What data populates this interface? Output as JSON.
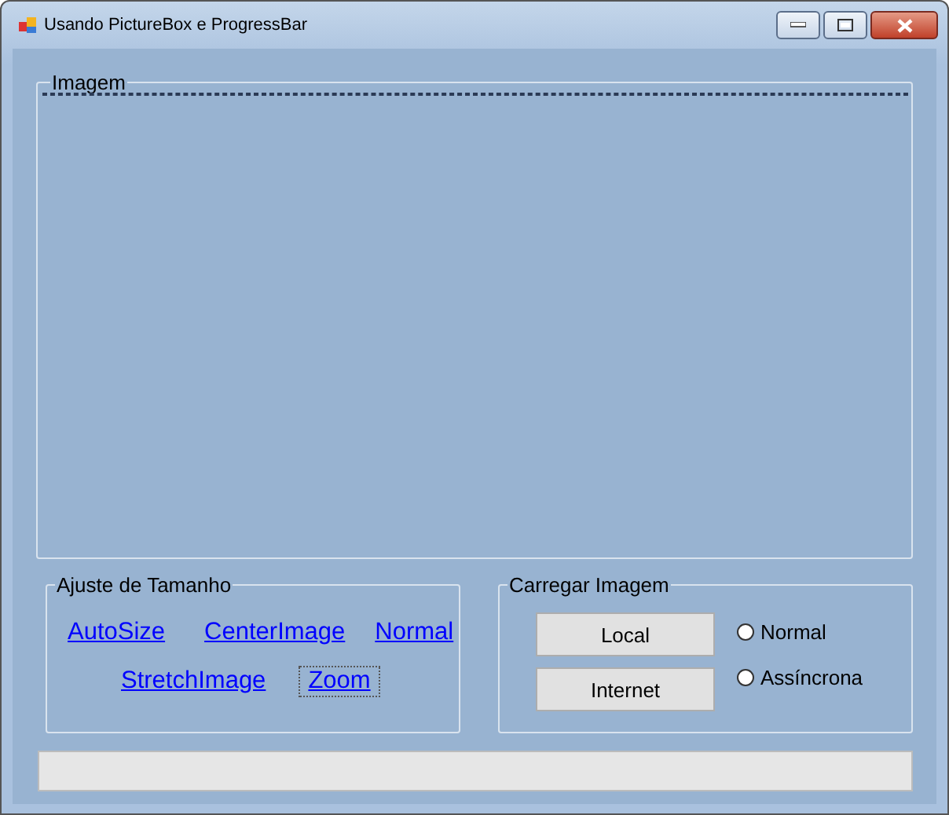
{
  "window": {
    "title": "Usando PictureBox e ProgressBar"
  },
  "image_group": {
    "title": "Imagem"
  },
  "size_group": {
    "title": "Ajuste de Tamanho",
    "links": [
      {
        "label": "AutoSize",
        "focused": false
      },
      {
        "label": "CenterImage",
        "focused": false
      },
      {
        "label": "Normal",
        "focused": false
      },
      {
        "label": "StretchImage",
        "focused": false
      },
      {
        "label": "Zoom",
        "focused": true
      }
    ]
  },
  "load_group": {
    "title": "Carregar Imagem",
    "buttons": [
      "Local",
      "Internet"
    ],
    "options": [
      {
        "label": "Normal",
        "selected": false
      },
      {
        "label": "Assíncrona",
        "selected": false
      }
    ]
  },
  "progress": {
    "level": 0
  }
}
